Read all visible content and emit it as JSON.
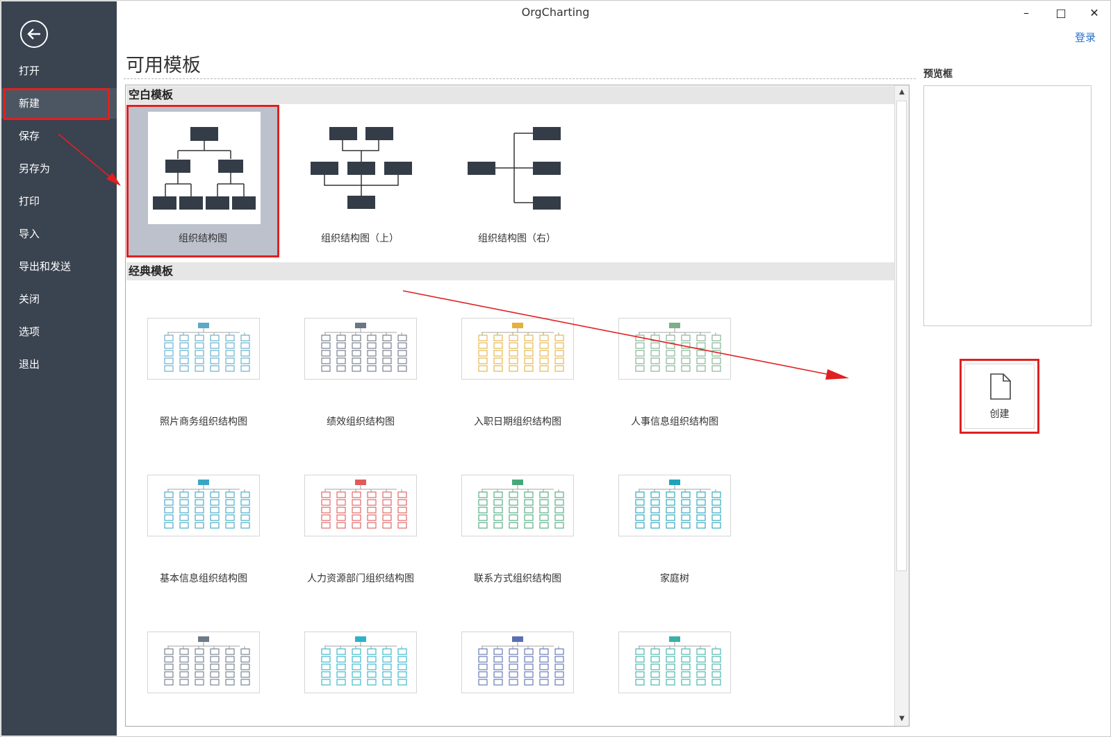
{
  "app": {
    "title": "OrgCharting",
    "login": "登录"
  },
  "window": {
    "minimize": "–",
    "maximize": "□",
    "close": "✕"
  },
  "sidebar": {
    "items": [
      {
        "label": "打开"
      },
      {
        "label": "新建",
        "active": true
      },
      {
        "label": "保存"
      },
      {
        "label": "另存为"
      },
      {
        "label": "打印"
      },
      {
        "label": "导入"
      },
      {
        "label": "导出和发送"
      },
      {
        "label": "关闭"
      },
      {
        "label": "选项"
      },
      {
        "label": "退出"
      }
    ]
  },
  "main": {
    "heading": "可用模板",
    "blank_section": "空白模板",
    "classic_section": "经典模板",
    "blank_templates": [
      {
        "label": "组织结构图"
      },
      {
        "label": "组织结构图（上）"
      },
      {
        "label": "组织结构图（右）"
      }
    ],
    "classic_templates": [
      {
        "label": "照片商务组织结构图",
        "color": "#5aa9c9"
      },
      {
        "label": "绩效组织结构图",
        "color": "#6b7585"
      },
      {
        "label": "入职日期组织结构图",
        "color": "#e4b13c"
      },
      {
        "label": "人事信息组织结构图",
        "color": "#7fae8c"
      },
      {
        "label": "基本信息组织结构图",
        "color": "#3aa6c4"
      },
      {
        "label": "人力资源部门组织结构图",
        "color": "#e05a5a"
      },
      {
        "label": "联系方式组织结构图",
        "color": "#46a87a"
      },
      {
        "label": "家庭树",
        "color": "#1fa3b8"
      },
      {
        "label": "",
        "color": "#6c7a89"
      },
      {
        "label": "",
        "color": "#2bb3c9"
      },
      {
        "label": "",
        "color": "#5a6fb0"
      },
      {
        "label": "",
        "color": "#3bb0a8"
      }
    ]
  },
  "preview": {
    "label": "预览框"
  },
  "create": {
    "label": "创建"
  },
  "scroll": {
    "up": "▲",
    "down": "▼"
  }
}
